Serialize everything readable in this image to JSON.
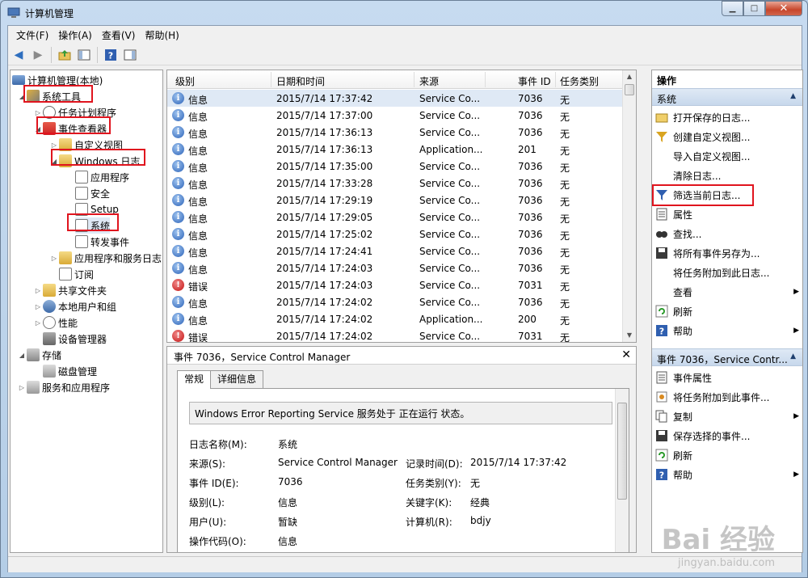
{
  "window": {
    "title": "计算机管理"
  },
  "menu": [
    "文件(F)",
    "操作(A)",
    "查看(V)",
    "帮助(H)"
  ],
  "tree": [
    {
      "label": "计算机管理(本地)",
      "icon": "computer-icon"
    },
    {
      "label": "系统工具",
      "icon": "tools-icon"
    },
    {
      "label": "任务计划程序",
      "icon": "clock-icon"
    },
    {
      "label": "事件查看器",
      "icon": "event-viewer-icon"
    },
    {
      "label": "自定义视图",
      "icon": "folder-icon"
    },
    {
      "label": "Windows 日志",
      "icon": "folder-icon"
    },
    {
      "label": "应用程序",
      "icon": "log-icon"
    },
    {
      "label": "安全",
      "icon": "log-icon"
    },
    {
      "label": "Setup",
      "icon": "log-icon"
    },
    {
      "label": "系统",
      "icon": "log-icon"
    },
    {
      "label": "转发事件",
      "icon": "log-icon"
    },
    {
      "label": "应用程序和服务日志",
      "icon": "folder-icon"
    },
    {
      "label": "订阅",
      "icon": "subscription-icon"
    },
    {
      "label": "共享文件夹",
      "icon": "shared-folder-icon"
    },
    {
      "label": "本地用户和组",
      "icon": "users-icon"
    },
    {
      "label": "性能",
      "icon": "performance-icon"
    },
    {
      "label": "设备管理器",
      "icon": "device-manager-icon"
    },
    {
      "label": "存储",
      "icon": "storage-icon"
    },
    {
      "label": "磁盘管理",
      "icon": "disk-icon"
    },
    {
      "label": "服务和应用程序",
      "icon": "services-icon"
    }
  ],
  "list": {
    "headers": [
      "级别",
      "日期和时间",
      "来源",
      "事件 ID",
      "任务类别"
    ],
    "rows": [
      {
        "level": "信息",
        "type": "info",
        "datetime": "2015/7/14 17:37:42",
        "source": "Service Co...",
        "id": "7036",
        "category": "无"
      },
      {
        "level": "信息",
        "type": "info",
        "datetime": "2015/7/14 17:37:00",
        "source": "Service Co...",
        "id": "7036",
        "category": "无"
      },
      {
        "level": "信息",
        "type": "info",
        "datetime": "2015/7/14 17:36:13",
        "source": "Service Co...",
        "id": "7036",
        "category": "无"
      },
      {
        "level": "信息",
        "type": "info",
        "datetime": "2015/7/14 17:36:13",
        "source": "Application...",
        "id": "201",
        "category": "无"
      },
      {
        "level": "信息",
        "type": "info",
        "datetime": "2015/7/14 17:35:00",
        "source": "Service Co...",
        "id": "7036",
        "category": "无"
      },
      {
        "level": "信息",
        "type": "info",
        "datetime": "2015/7/14 17:33:28",
        "source": "Service Co...",
        "id": "7036",
        "category": "无"
      },
      {
        "level": "信息",
        "type": "info",
        "datetime": "2015/7/14 17:29:19",
        "source": "Service Co...",
        "id": "7036",
        "category": "无"
      },
      {
        "level": "信息",
        "type": "info",
        "datetime": "2015/7/14 17:29:05",
        "source": "Service Co...",
        "id": "7036",
        "category": "无"
      },
      {
        "level": "信息",
        "type": "info",
        "datetime": "2015/7/14 17:25:02",
        "source": "Service Co...",
        "id": "7036",
        "category": "无"
      },
      {
        "level": "信息",
        "type": "info",
        "datetime": "2015/7/14 17:24:41",
        "source": "Service Co...",
        "id": "7036",
        "category": "无"
      },
      {
        "level": "信息",
        "type": "info",
        "datetime": "2015/7/14 17:24:03",
        "source": "Service Co...",
        "id": "7036",
        "category": "无"
      },
      {
        "level": "错误",
        "type": "error",
        "datetime": "2015/7/14 17:24:03",
        "source": "Service Co...",
        "id": "7031",
        "category": "无"
      },
      {
        "level": "信息",
        "type": "info",
        "datetime": "2015/7/14 17:24:02",
        "source": "Service Co...",
        "id": "7036",
        "category": "无"
      },
      {
        "level": "信息",
        "type": "info",
        "datetime": "2015/7/14 17:24:02",
        "source": "Application...",
        "id": "200",
        "category": "无"
      },
      {
        "level": "错误",
        "type": "error",
        "datetime": "2015/7/14 17:24:02",
        "source": "Service Co...",
        "id": "7031",
        "category": "无"
      }
    ]
  },
  "detail": {
    "title": "事件 7036，Service Control Manager",
    "tabs": [
      "常规",
      "详细信息"
    ],
    "message": "Windows Error Reporting Service 服务处于 正在运行 状态。",
    "fields": {
      "log_name_label": "日志名称(M):",
      "log_name": "系统",
      "source_label": "来源(S):",
      "source": "Service Control Manager",
      "logged_label": "记录时间(D):",
      "logged": "2015/7/14 17:37:42",
      "event_id_label": "事件 ID(E):",
      "event_id": "7036",
      "category_label": "任务类别(Y):",
      "category": "无",
      "level_label": "级别(L):",
      "level": "信息",
      "keywords_label": "关键字(K):",
      "keywords": "经典",
      "user_label": "用户(U):",
      "user": "暂缺",
      "computer_label": "计算机(R):",
      "computer": "bdjy",
      "opcode_label": "操作代码(O):",
      "opcode": "信息"
    }
  },
  "actions": {
    "header": "操作",
    "section1": "系统",
    "items1": [
      {
        "label": "打开保存的日志...",
        "icon": "open-log-icon"
      },
      {
        "label": "创建自定义视图...",
        "icon": "filter-create-icon"
      },
      {
        "label": "导入自定义视图...",
        "icon": ""
      },
      {
        "label": "清除日志...",
        "icon": ""
      },
      {
        "label": "筛选当前日志...",
        "icon": "filter-icon"
      },
      {
        "label": "属性",
        "icon": "properties-icon"
      },
      {
        "label": "查找...",
        "icon": "find-icon"
      },
      {
        "label": "将所有事件另存为...",
        "icon": "save-icon"
      },
      {
        "label": "将任务附加到此日志...",
        "icon": ""
      },
      {
        "label": "查看",
        "icon": "",
        "submenu": true
      },
      {
        "label": "刷新",
        "icon": "refresh-icon"
      },
      {
        "label": "帮助",
        "icon": "help-icon",
        "submenu": true
      }
    ],
    "section2": "事件 7036，Service Contr...",
    "items2": [
      {
        "label": "事件属性",
        "icon": "properties-icon"
      },
      {
        "label": "将任务附加到此事件...",
        "icon": "attach-task-icon"
      },
      {
        "label": "复制",
        "icon": "copy-icon",
        "submenu": true
      },
      {
        "label": "保存选择的事件...",
        "icon": "save-icon"
      },
      {
        "label": "刷新",
        "icon": "refresh-icon"
      },
      {
        "label": "帮助",
        "icon": "help-icon",
        "submenu": true
      }
    ]
  },
  "watermark": {
    "text": "Bai 经验",
    "sub": "jingyan.baidu.com"
  }
}
